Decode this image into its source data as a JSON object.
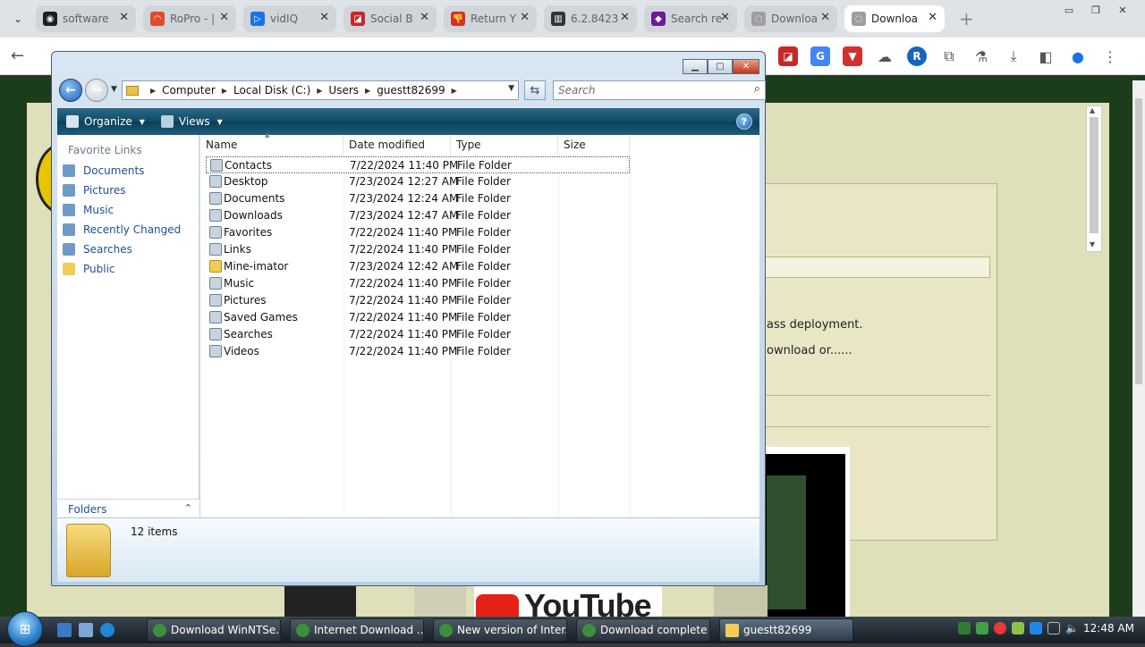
{
  "browser": {
    "tabs": [
      {
        "label": "software",
        "color": "#1b1f23",
        "glyph": "◉"
      },
      {
        "label": "RoPro - |",
        "color": "#e24a2b",
        "glyph": "◠"
      },
      {
        "label": "vidIQ",
        "color": "#1a73e8",
        "glyph": "▷"
      },
      {
        "label": "Social B",
        "color": "#c62828",
        "glyph": "◪"
      },
      {
        "label": "Return Y",
        "color": "#d32f2f",
        "glyph": "👎"
      },
      {
        "label": "6.2.8423",
        "color": "#333333",
        "glyph": "▥"
      },
      {
        "label": "Search re",
        "color": "#6a1b9a",
        "glyph": "◆"
      },
      {
        "label": "Downloa",
        "color": "#9e9e9e",
        "glyph": "◌"
      },
      {
        "label": "Downloa",
        "color": "#9e9e9e",
        "glyph": "◌",
        "active": true
      }
    ]
  },
  "page": {
    "text1": "ass deployment.",
    "text2": "ownload or......",
    "yt_text": "YouTube"
  },
  "explorer": {
    "breadcrumb": [
      "Computer",
      "Local Disk (C:)",
      "Users",
      "guestt82699"
    ],
    "search_placeholder": "Search",
    "commands": {
      "organize": "Organize",
      "views": "Views",
      "help": "?"
    },
    "favorite_links_header": "Favorite Links",
    "favorite_links": [
      {
        "label": "Documents",
        "icon": "documents-icon",
        "color": "#6f9ac7"
      },
      {
        "label": "Pictures",
        "icon": "pictures-icon",
        "color": "#6f9ac7"
      },
      {
        "label": "Music",
        "icon": "music-icon",
        "color": "#6f9ac7"
      },
      {
        "label": "Recently Changed",
        "icon": "recently-changed-icon",
        "color": "#6f9ac7"
      },
      {
        "label": "Searches",
        "icon": "searches-icon",
        "color": "#6f9ac7"
      },
      {
        "label": "Public",
        "icon": "public-folder-icon",
        "color": "#f2cc56"
      }
    ],
    "folders_label": "Folders",
    "columns": {
      "name": "Name",
      "date": "Date modified",
      "type": "Type",
      "size": "Size"
    },
    "files": [
      {
        "name": "Contacts",
        "date": "7/22/2024 11:40 PM",
        "type": "File Folder",
        "selected": true
      },
      {
        "name": "Desktop",
        "date": "7/23/2024 12:27 AM",
        "type": "File Folder"
      },
      {
        "name": "Documents",
        "date": "7/23/2024 12:24 AM",
        "type": "File Folder"
      },
      {
        "name": "Downloads",
        "date": "7/23/2024 12:47 AM",
        "type": "File Folder"
      },
      {
        "name": "Favorites",
        "date": "7/22/2024 11:40 PM",
        "type": "File Folder"
      },
      {
        "name": "Links",
        "date": "7/22/2024 11:40 PM",
        "type": "File Folder"
      },
      {
        "name": "Mine-imator",
        "date": "7/23/2024 12:42 AM",
        "type": "File Folder",
        "yellow": true
      },
      {
        "name": "Music",
        "date": "7/22/2024 11:40 PM",
        "type": "File Folder"
      },
      {
        "name": "Pictures",
        "date": "7/22/2024 11:40 PM",
        "type": "File Folder"
      },
      {
        "name": "Saved Games",
        "date": "7/22/2024 11:40 PM",
        "type": "File Folder"
      },
      {
        "name": "Searches",
        "date": "7/22/2024 11:40 PM",
        "type": "File Folder"
      },
      {
        "name": "Videos",
        "date": "7/22/2024 11:40 PM",
        "type": "File Folder"
      }
    ],
    "item_count": "12 items"
  },
  "taskbar": {
    "tasks": [
      {
        "label": "Download WinNTSe...",
        "icon": "chrome-icon"
      },
      {
        "label": "Internet Download ...",
        "icon": "chrome-icon"
      },
      {
        "label": "New version of Inter...",
        "icon": "chrome-icon"
      },
      {
        "label": "Download complete",
        "icon": "chrome-icon"
      },
      {
        "label": "guestt82699",
        "icon": "folder-icon",
        "active": true
      }
    ],
    "clock": "12:48 AM"
  }
}
